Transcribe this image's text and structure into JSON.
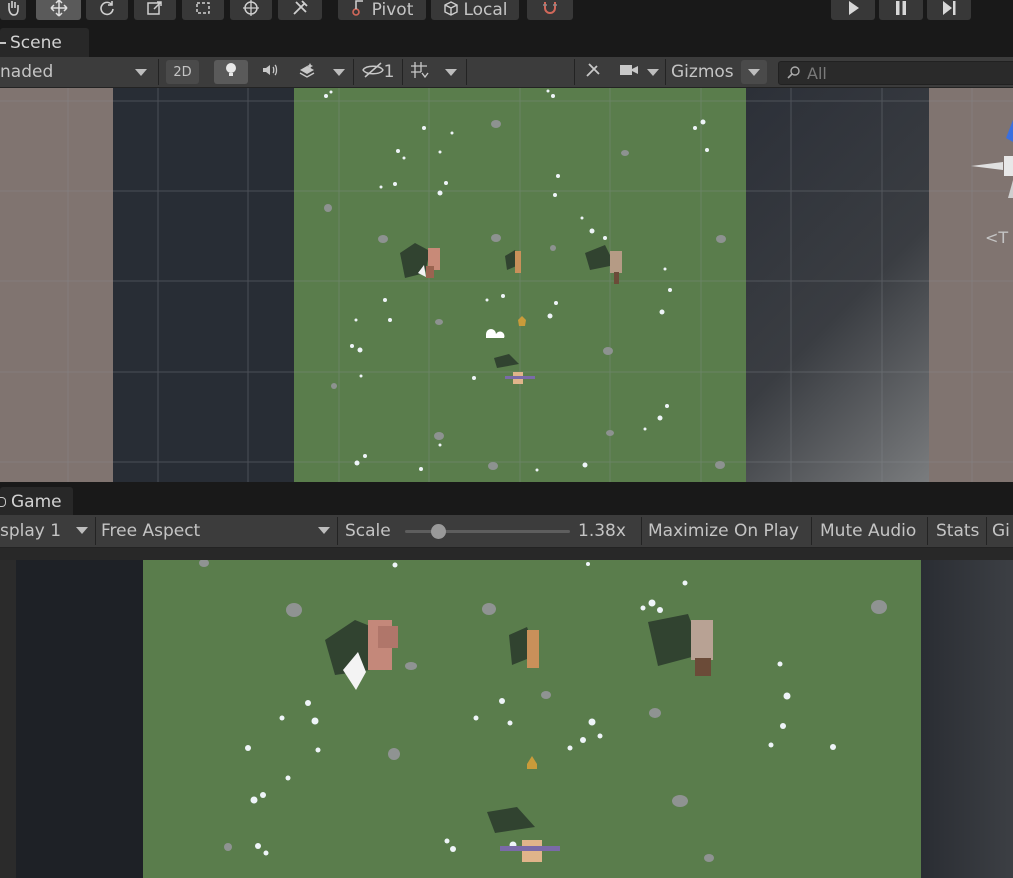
{
  "toolbar": {
    "pivot_label": "Pivot",
    "local_label": "Local"
  },
  "scene": {
    "tab_label": "Scene",
    "shading_mode": "naded",
    "btn_2d": "2D",
    "hidden_count": "1",
    "gizmos_label": "Gizmos",
    "search_placeholder": "All",
    "gizmo_axis_label": "T"
  },
  "game": {
    "tab_label": "Game",
    "display_label": "splay 1",
    "aspect_label": "Free Aspect",
    "scale_label": "Scale",
    "scale_value": "1.38x",
    "scale_fraction": 0.2,
    "maximize_label": "Maximize On Play",
    "mute_label": "Mute Audio",
    "stats_label": "Stats",
    "gizmos_label": "Gi"
  },
  "colors": {
    "grass": "#5a7d4c",
    "panel": "#3c3c3c",
    "toolbar_bg": "#191919",
    "accent_red": "#d2685a",
    "gizmo_blue": "#3a6fe0"
  }
}
